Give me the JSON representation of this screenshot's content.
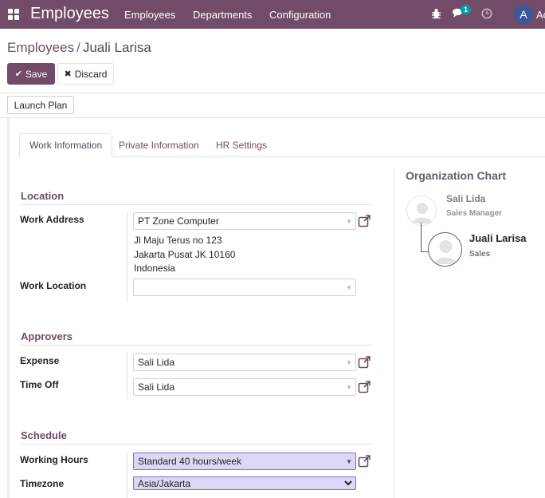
{
  "navbar": {
    "app_title": "Employees",
    "menu": [
      "Employees",
      "Departments",
      "Configuration"
    ],
    "chat_badge": "1",
    "avatar_letter": "A",
    "user_cut": "Ac"
  },
  "breadcrumb": {
    "parent": "Employees",
    "separator": "/",
    "current": "Juali Larisa"
  },
  "buttons": {
    "save": "Save",
    "discard": "Discard",
    "launch_plan": "Launch Plan"
  },
  "tabs": [
    "Work Information",
    "Private Information",
    "HR Settings"
  ],
  "location": {
    "title": "Location",
    "work_address_label": "Work Address",
    "work_address_value": "PT Zone Computer",
    "address_lines": [
      "Jl Maju Terus no 123",
      "Jakarta Pusat JK 10160",
      "Indonesia"
    ],
    "work_location_label": "Work Location",
    "work_location_value": ""
  },
  "approvers": {
    "title": "Approvers",
    "expense_label": "Expense",
    "expense_value": "Sali Lida",
    "timeoff_label": "Time Off",
    "timeoff_value": "Sali Lida"
  },
  "schedule": {
    "title": "Schedule",
    "working_hours_label": "Working Hours",
    "working_hours_value": "Standard 40 hours/week",
    "timezone_label": "Timezone",
    "timezone_value": "Asia/Jakarta"
  },
  "org_chart": {
    "title": "Organization Chart",
    "manager_name": "Sali Lida",
    "manager_job": "Sales Manager",
    "employee_name": "Juali Larisa",
    "employee_job": "Sales"
  },
  "colors": {
    "brand": "#714b67",
    "highlight_field": "#dcd7f5",
    "badge": "#00a09d"
  }
}
